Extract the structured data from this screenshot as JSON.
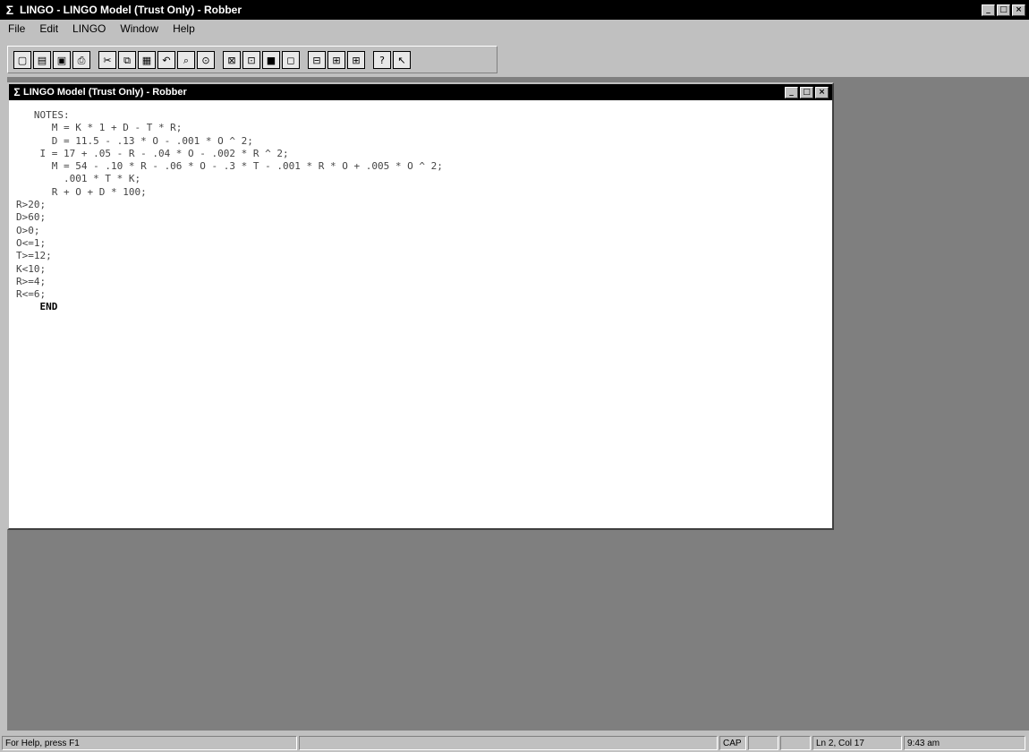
{
  "app": {
    "title": "LINGO - LINGO Model (Trust Only) - Robber",
    "icon": "sigma-icon",
    "controls": [
      "minimize",
      "maximize",
      "close"
    ]
  },
  "menu": {
    "items": [
      "File",
      "Edit",
      "LINGO",
      "Window",
      "Help"
    ]
  },
  "toolbar": {
    "groups": [
      [
        "new",
        "open",
        "save",
        "print"
      ],
      [
        "cut",
        "copy",
        "paste",
        "undo",
        "find",
        "goto"
      ],
      [
        "solve",
        "report",
        "window",
        "match"
      ],
      [
        "options",
        "tile",
        "cascade"
      ],
      [
        "help",
        "context-help"
      ]
    ]
  },
  "child": {
    "title": "LINGO Model (Trust Only) - Robber"
  },
  "editor": {
    "lines": [
      "   NOTES:",
      "      M = K * 1 + D - T * R;",
      "      D = 11.5 - .13 * O - .001 * O ^ 2;",
      "    I = 17 + .05 - R - .04 * O - .002 * R ^ 2;",
      "      M = 54 - .10 * R - .06 * O - .3 * T - .001 * R * O + .005 * O ^ 2;",
      "        .001 * T * K;",
      "      R + O + D * 100;",
      "R>20;",
      "D>60;",
      "O>0;",
      "O<=1;",
      "T>=12;",
      "K<10;",
      "R>=4;",
      "R<=6;",
      "    END"
    ]
  },
  "status": {
    "left": "For Help, press F1",
    "mode": "CAP",
    "position": "Ln 2, Col 17",
    "time": "9:43 am"
  }
}
